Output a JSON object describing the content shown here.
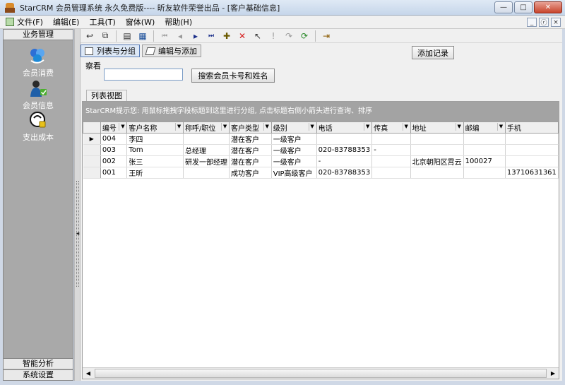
{
  "window": {
    "title": "StarCRM 会员管理系统 永久免费版---- 昕友软件荣誉出品 - [客户基础信息]",
    "minimize_glyph": "—",
    "maximize_glyph": "□",
    "close_glyph": "✕"
  },
  "menubar": {
    "items": [
      {
        "label": "文件(F)"
      },
      {
        "label": "编辑(E)"
      },
      {
        "label": "工具(T)"
      },
      {
        "label": "窗体(W)"
      },
      {
        "label": "帮助(H)"
      }
    ],
    "mdi_buttons": [
      "_",
      "ⓡ",
      "×"
    ]
  },
  "sidebar": {
    "header": "业务管理",
    "entries": [
      {
        "label": "会员消费",
        "icon": "members-consume-icon"
      },
      {
        "label": "会员信息",
        "icon": "member-info-icon"
      },
      {
        "label": "支出成本",
        "icon": "expense-cost-icon"
      }
    ],
    "footer": [
      "智能分析",
      "系统设置"
    ]
  },
  "toolbar": {
    "buttons": [
      {
        "name": "back-icon",
        "glyph": "↩"
      },
      {
        "name": "windows-icon",
        "glyph": "⧉"
      },
      {
        "name": "report-icon",
        "glyph": "▤"
      },
      {
        "name": "grid-icon",
        "glyph": "▦"
      },
      {
        "name": "first-record-icon",
        "glyph": "⏮"
      },
      {
        "name": "prev-record-icon",
        "glyph": "◂"
      },
      {
        "name": "next-record-icon",
        "glyph": "▸"
      },
      {
        "name": "last-record-icon",
        "glyph": "⏭"
      },
      {
        "name": "add-icon",
        "glyph": "✚"
      },
      {
        "name": "delete-icon",
        "glyph": "✕"
      },
      {
        "name": "pointer-icon",
        "glyph": "↖"
      },
      {
        "name": "exclaim-icon",
        "glyph": "!"
      },
      {
        "name": "redo-icon",
        "glyph": "↷"
      },
      {
        "name": "refresh-icon",
        "glyph": "⟳"
      },
      {
        "name": "exit-icon",
        "glyph": "⇥"
      }
    ]
  },
  "view_tabs": {
    "list_group": "列表与分组",
    "edit_add": "编辑与添加"
  },
  "add_record_label": "添加记录",
  "search": {
    "legend": "察看",
    "input_value": "",
    "button_label": "搜索会员卡号和姓名"
  },
  "grid": {
    "tab_label": "列表视图",
    "group_hint": "StarCRM提示您: 用鼠标拖拽字段标题到这里进行分组, 点击标题右侧小箭头进行查询、排序",
    "columns": [
      "编号",
      "客户名称",
      "称呼/职位",
      "客户类型",
      "级别",
      "电话",
      "传真",
      "地址",
      "邮编",
      "手机"
    ],
    "rows": [
      {
        "indicator": "▶",
        "cells": [
          "004",
          "李四",
          "",
          "潜在客户",
          "一级客户",
          "",
          "",
          "",
          "",
          ""
        ]
      },
      {
        "indicator": "",
        "cells": [
          "003",
          "Tom",
          "总经理",
          "潜在客户",
          "一级客户",
          "020-83788353",
          "-",
          "",
          "",
          ""
        ]
      },
      {
        "indicator": "",
        "cells": [
          "002",
          "张三",
          "研发一部经理",
          "潜在客户",
          "一级客户",
          "-",
          "",
          "北京朝阳区霄云",
          "100027",
          ""
        ]
      },
      {
        "indicator": "",
        "cells": [
          "001",
          "王昕",
          "",
          "成功客户",
          "VIP高级客户",
          "020-83788353",
          "",
          "",
          "",
          "13710631361"
        ]
      }
    ]
  },
  "colors": {
    "sidebar_bg": "#a9a9a9",
    "group_panel_bg": "#a3a3a3",
    "titlebar": "#c6d6ea"
  }
}
